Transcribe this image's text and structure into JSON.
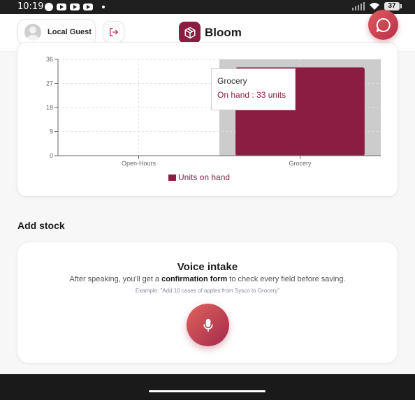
{
  "status_bar": {
    "time": "10:19",
    "battery": "37"
  },
  "header": {
    "guest_name": "Local Guest",
    "brand_name": "Bloom",
    "icons": [
      "avatar-icon",
      "logout-icon",
      "package-icon",
      "chat-icon"
    ]
  },
  "chart_data": {
    "type": "bar",
    "categories": [
      "Open-Hours",
      "Grocery"
    ],
    "series": [
      {
        "name": "Units on hand",
        "values": [
          0,
          33
        ]
      }
    ],
    "ylim": [
      0,
      36
    ],
    "yticks": [
      "0",
      "9",
      "18",
      "27",
      "36"
    ],
    "grid": true,
    "legend": "bottom",
    "highlight_category": "Grocery",
    "tooltip": {
      "title": "Grocery",
      "label": "On hand",
      "value_text": "33 units"
    },
    "colors": {
      "bar": "#8b1d42",
      "highlight": "#cccccc"
    }
  },
  "add_stock": {
    "title": "Add stock",
    "voice_title": "Voice intake",
    "desc_before": "After speaking, you'll get a ",
    "desc_bold": "confirmation form",
    "desc_after": " to check every field before saving.",
    "example": "Example: \"Add 10 cases of apples from Sysco to Grocery\""
  },
  "colors": {
    "accent": "#8b1d42"
  }
}
